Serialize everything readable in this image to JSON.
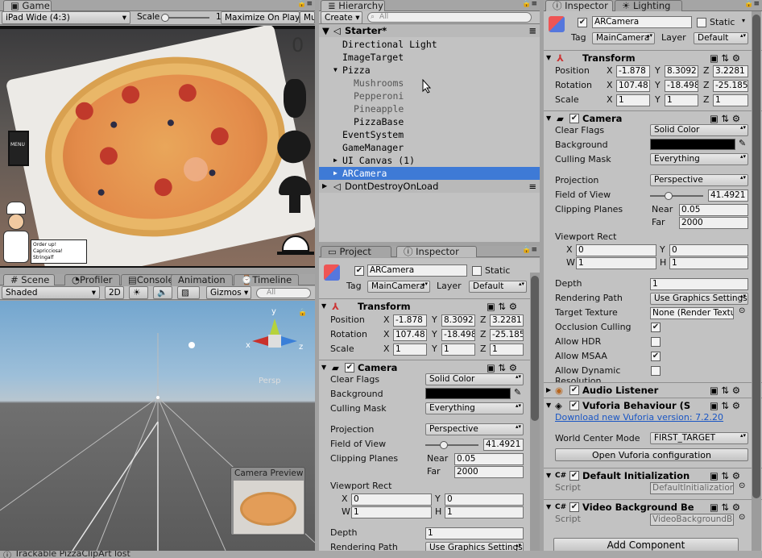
{
  "game": {
    "tab": "Game",
    "aspect": "iPad Wide (4:3)",
    "scale_label": "Scale",
    "scale_value": "1x",
    "maximize": "Maximize On Play",
    "mute": "Mu",
    "score": "0",
    "menu_label": "MENU",
    "speech1": "Order up!",
    "speech2": "Capricciosa! Stringalf"
  },
  "hierarchy": {
    "tab": "Hierarchy",
    "create": "Create",
    "search_placeholder": "All",
    "scene": "Starter*",
    "items": [
      {
        "label": "Directional Light"
      },
      {
        "label": "ImageTarget"
      },
      {
        "label": "Pizza"
      },
      {
        "label": "Mushrooms"
      },
      {
        "label": "Pepperoni"
      },
      {
        "label": "Pineapple"
      },
      {
        "label": "PizzaBase"
      },
      {
        "label": "EventSystem"
      },
      {
        "label": "GameManager"
      },
      {
        "label": "UI Canvas (1)"
      },
      {
        "label": "ARCamera"
      },
      {
        "label": "DontDestroyOnLoad"
      }
    ]
  },
  "scene": {
    "tabs": [
      "Scene",
      "Profiler",
      "Console",
      "Animation",
      "Timeline"
    ],
    "shading": "Shaded",
    "mode2d": "2D",
    "gizmos": "Gizmos",
    "search_placeholder": "All",
    "persp": "Persp",
    "axis_y": "y",
    "axis_x": "x",
    "axis_z": "z",
    "camera_preview": "Camera Preview"
  },
  "mid_inspector": {
    "tabs": [
      "Project",
      "Inspector"
    ]
  },
  "inspector": {
    "tabs": [
      "Inspector",
      "Lighting"
    ],
    "name": "ARCamera",
    "static": "Static",
    "tag_label": "Tag",
    "tag": "MainCamera",
    "layer_label": "Layer",
    "layer": "Default",
    "transform": {
      "title": "Transform",
      "position": {
        "label": "Position",
        "x": "-1.878",
        "y": "8.3092",
        "z": "3.2281"
      },
      "rotation": {
        "label": "Rotation",
        "x": "107.48",
        "y": "-18.498",
        "z": "-25.185"
      },
      "scale": {
        "label": "Scale",
        "x": "1",
        "y": "1",
        "z": "1"
      }
    },
    "camera": {
      "title": "Camera",
      "clear_flags_label": "Clear Flags",
      "clear_flags": "Solid Color",
      "background_label": "Background",
      "culling_label": "Culling Mask",
      "culling": "Everything",
      "projection_label": "Projection",
      "projection": "Perspective",
      "fov_label": "Field of View",
      "fov": "41.4921",
      "fov_fraction": 0.35,
      "clipping_label": "Clipping Planes",
      "near_label": "Near",
      "near": "0.05",
      "far_label": "Far",
      "far": "2000",
      "viewport_label": "Viewport Rect",
      "vx": "0",
      "vy": "0",
      "vw": "1",
      "vh": "1",
      "depth_label": "Depth",
      "depth": "1",
      "rendering_label": "Rendering Path",
      "rendering": "Use Graphics Settings",
      "target_label": "Target Texture",
      "target": "None (Render Texture)",
      "occlusion_label": "Occlusion Culling",
      "hdr_label": "Allow HDR",
      "msaa_label": "Allow MSAA",
      "dyn_label": "Allow Dynamic Resolution"
    },
    "audio": {
      "title": "Audio Listener"
    },
    "vuforia": {
      "title": "Vuforia Behaviour (S",
      "link": "Download new Vuforia version: 7.2.20",
      "wcm_label": "World Center Mode",
      "wcm": "FIRST_TARGET",
      "open": "Open Vuforia configuration"
    },
    "default_init": {
      "title": "Default Initialization",
      "script_label": "Script",
      "script": "DefaultInitializationErrorHandler"
    },
    "video_bg": {
      "title": "Video Background Be",
      "script_label": "Script",
      "script": "VideoBackgroundBehaviour"
    },
    "add_component": "Add Component"
  },
  "status": {
    "text": "Trackable PizzaClipArt lost"
  }
}
